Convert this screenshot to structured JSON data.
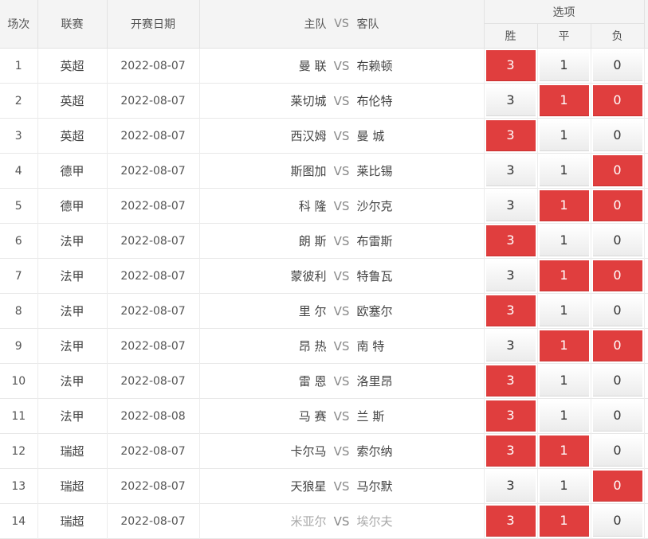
{
  "headers": {
    "index": "场次",
    "league": "联赛",
    "date": "开赛日期",
    "matchup": {
      "home": "主队",
      "vs": "VS",
      "away": "客队"
    },
    "options": "选项",
    "win": "胜",
    "draw": "平",
    "lose": "负"
  },
  "colors": {
    "selected": "#e03e3e",
    "header_bg": "#f4f4f4"
  },
  "rows": [
    {
      "no": "1",
      "league": "英超",
      "date": "2022-08-07",
      "home": "曼 联",
      "vs": "VS",
      "away": "布赖顿",
      "win": "3",
      "draw": "1",
      "lose": "0",
      "sel": [
        true,
        false,
        false
      ],
      "faded": false
    },
    {
      "no": "2",
      "league": "英超",
      "date": "2022-08-07",
      "home": "莱切城",
      "vs": "VS",
      "away": "布伦特",
      "win": "3",
      "draw": "1",
      "lose": "0",
      "sel": [
        false,
        true,
        true
      ],
      "faded": false
    },
    {
      "no": "3",
      "league": "英超",
      "date": "2022-08-07",
      "home": "西汉姆",
      "vs": "VS",
      "away": "曼 城",
      "win": "3",
      "draw": "1",
      "lose": "0",
      "sel": [
        true,
        false,
        false
      ],
      "faded": false
    },
    {
      "no": "4",
      "league": "德甲",
      "date": "2022-08-07",
      "home": "斯图加",
      "vs": "VS",
      "away": "莱比锡",
      "win": "3",
      "draw": "1",
      "lose": "0",
      "sel": [
        false,
        false,
        true
      ],
      "faded": false
    },
    {
      "no": "5",
      "league": "德甲",
      "date": "2022-08-07",
      "home": "科 隆",
      "vs": "VS",
      "away": "沙尔克",
      "win": "3",
      "draw": "1",
      "lose": "0",
      "sel": [
        false,
        true,
        true
      ],
      "faded": false
    },
    {
      "no": "6",
      "league": "法甲",
      "date": "2022-08-07",
      "home": "朗 斯",
      "vs": "VS",
      "away": "布雷斯",
      "win": "3",
      "draw": "1",
      "lose": "0",
      "sel": [
        true,
        false,
        false
      ],
      "faded": false
    },
    {
      "no": "7",
      "league": "法甲",
      "date": "2022-08-07",
      "home": "蒙彼利",
      "vs": "VS",
      "away": "特鲁瓦",
      "win": "3",
      "draw": "1",
      "lose": "0",
      "sel": [
        false,
        true,
        true
      ],
      "faded": false
    },
    {
      "no": "8",
      "league": "法甲",
      "date": "2022-08-07",
      "home": "里 尔",
      "vs": "VS",
      "away": "欧塞尔",
      "win": "3",
      "draw": "1",
      "lose": "0",
      "sel": [
        true,
        false,
        false
      ],
      "faded": false
    },
    {
      "no": "9",
      "league": "法甲",
      "date": "2022-08-07",
      "home": "昂 热",
      "vs": "VS",
      "away": "南 特",
      "win": "3",
      "draw": "1",
      "lose": "0",
      "sel": [
        false,
        true,
        true
      ],
      "faded": false
    },
    {
      "no": "10",
      "league": "法甲",
      "date": "2022-08-07",
      "home": "雷 恩",
      "vs": "VS",
      "away": "洛里昂",
      "win": "3",
      "draw": "1",
      "lose": "0",
      "sel": [
        true,
        false,
        false
      ],
      "faded": false
    },
    {
      "no": "11",
      "league": "法甲",
      "date": "2022-08-08",
      "home": "马 赛",
      "vs": "VS",
      "away": "兰 斯",
      "win": "3",
      "draw": "1",
      "lose": "0",
      "sel": [
        true,
        false,
        false
      ],
      "faded": false
    },
    {
      "no": "12",
      "league": "瑞超",
      "date": "2022-08-07",
      "home": "卡尔马",
      "vs": "VS",
      "away": "索尔纳",
      "win": "3",
      "draw": "1",
      "lose": "0",
      "sel": [
        true,
        true,
        false
      ],
      "faded": false
    },
    {
      "no": "13",
      "league": "瑞超",
      "date": "2022-08-07",
      "home": "天狼星",
      "vs": "VS",
      "away": "马尔默",
      "win": "3",
      "draw": "1",
      "lose": "0",
      "sel": [
        false,
        false,
        true
      ],
      "faded": false
    },
    {
      "no": "14",
      "league": "瑞超",
      "date": "2022-08-07",
      "home": "米亚尔",
      "vs": "VS",
      "away": "埃尔夫",
      "win": "3",
      "draw": "1",
      "lose": "0",
      "sel": [
        true,
        true,
        false
      ],
      "faded": true
    }
  ]
}
